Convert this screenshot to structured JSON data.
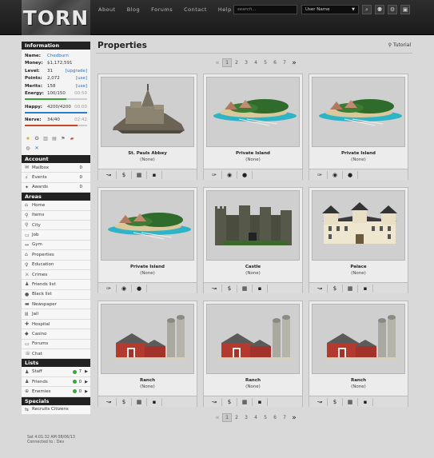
{
  "app": {
    "logo": "TORN"
  },
  "nav": [
    "About",
    "Blog",
    "Forums",
    "Contact",
    "Help"
  ],
  "search": {
    "placeholder": "search..."
  },
  "user_select": {
    "value": "User Name"
  },
  "information": {
    "title": "Information",
    "name_label": "Name:",
    "name": "Chedburn",
    "money_label": "Money:",
    "money": "$1,172,591",
    "level_label": "Level:",
    "level": "31",
    "level_link": "[upgrade]",
    "points_label": "Points:",
    "points": "2,072",
    "points_link": "[use]",
    "merits_label": "Merits:",
    "merits": "158",
    "merits_link": "[use]",
    "energy_label": "Energy:",
    "energy": "100/150",
    "energy_time": "00:50",
    "energy_fraction": 0.67,
    "happy_label": "Happy:",
    "happy": "4200/4200",
    "happy_time": "00:00",
    "happy_fraction": 1.0,
    "nerve_label": "Nerve:",
    "nerve": "34/40",
    "nerve_time": "02:42",
    "nerve_fraction": 0.85
  },
  "account": {
    "title": "Account",
    "items": [
      {
        "label": "Mailbox",
        "count": "0",
        "icon": "mail-icon"
      },
      {
        "label": "Events",
        "count": "0",
        "icon": "events-icon"
      },
      {
        "label": "Awards",
        "count": "0",
        "icon": "awards-icon"
      }
    ]
  },
  "areas": {
    "title": "Areas",
    "items": [
      {
        "label": "Home",
        "icon": "home-icon"
      },
      {
        "label": "Items",
        "icon": "items-icon"
      },
      {
        "label": "City",
        "icon": "city-icon"
      },
      {
        "label": "Job",
        "icon": "job-icon"
      },
      {
        "label": "Gym",
        "icon": "gym-icon"
      },
      {
        "label": "Properties",
        "icon": "properties-icon"
      },
      {
        "label": "Education",
        "icon": "education-icon"
      },
      {
        "label": "Crimes",
        "icon": "crimes-icon"
      },
      {
        "label": "Friends list",
        "icon": "friends-icon"
      },
      {
        "label": "Black list",
        "icon": "blacklist-icon"
      },
      {
        "label": "Newspaper",
        "icon": "newspaper-icon"
      },
      {
        "label": "Jail",
        "icon": "jail-icon"
      },
      {
        "label": "Hospital",
        "icon": "hospital-icon"
      },
      {
        "label": "Casino",
        "icon": "casino-icon"
      },
      {
        "label": "Forums",
        "icon": "forums-icon"
      },
      {
        "label": "Chat",
        "icon": "chat-icon"
      }
    ]
  },
  "lists": {
    "title": "Lists",
    "items": [
      {
        "label": "Staff",
        "count": "7",
        "icon": "staff-icon"
      },
      {
        "label": "Friends",
        "count": "0",
        "icon": "friends-icon"
      },
      {
        "label": "Enemies",
        "count": "0",
        "icon": "enemies-icon"
      }
    ]
  },
  "specials": {
    "title": "Specials",
    "items": [
      {
        "label": "Recruits Citizens",
        "icon": "recruit-icon"
      }
    ]
  },
  "clock": {
    "line1": "Sat 4:01:32 AM 08/06/13",
    "line2": "Connected to : Dev"
  },
  "main": {
    "title": "Properties",
    "tutorial": "Tutorial"
  },
  "pager": {
    "first": "«",
    "pages": [
      "1",
      "2",
      "3",
      "4",
      "5",
      "6",
      "7"
    ],
    "last": "»",
    "current": "1"
  },
  "properties": [
    {
      "name": "St. Pauls Abbey",
      "status": "(None)",
      "kind": "abbey"
    },
    {
      "name": "Private Island",
      "status": "(None)",
      "kind": "island"
    },
    {
      "name": "Private Island",
      "status": "(None)",
      "kind": "island"
    },
    {
      "name": "Private Island",
      "status": "(None)",
      "kind": "island"
    },
    {
      "name": "Castle",
      "status": "(None)",
      "kind": "castle"
    },
    {
      "name": "Palace",
      "status": "(None)",
      "kind": "palace"
    },
    {
      "name": "Ranch",
      "status": "(None)",
      "kind": "ranch"
    },
    {
      "name": "Ranch",
      "status": "(None)",
      "kind": "ranch"
    },
    {
      "name": "Ranch",
      "status": "(None)",
      "kind": "ranch"
    }
  ],
  "colors": {
    "energy": "#3aa33a",
    "happy": "#2a7fc9",
    "nerve": "#cc4422"
  }
}
